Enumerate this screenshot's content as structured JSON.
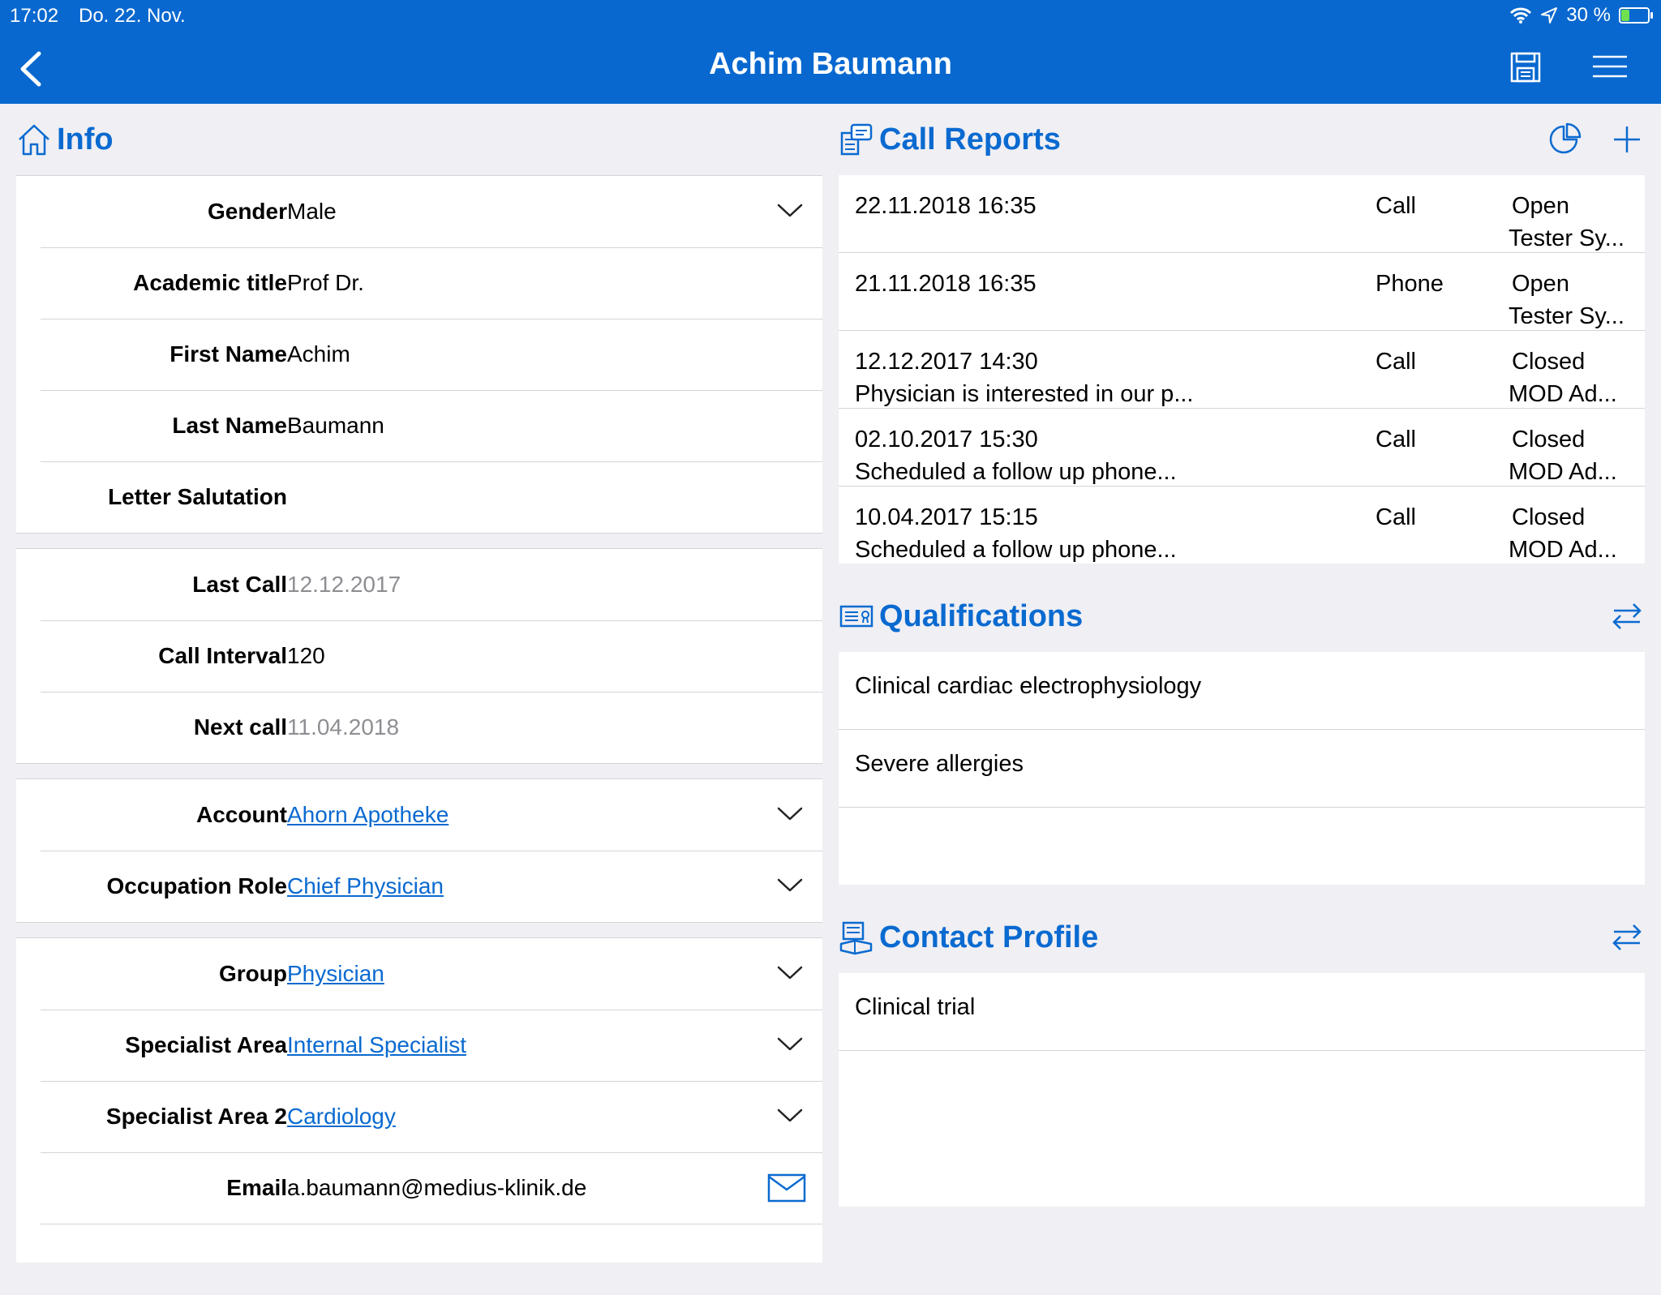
{
  "status": {
    "time": "17:02",
    "date": "Do. 22. Nov.",
    "battery": "30 %",
    "battery_level": 0.3
  },
  "nav": {
    "title": "Achim Baumann"
  },
  "info": {
    "title": "Info",
    "group1": [
      {
        "label": "Gender",
        "value": "Male"
      },
      {
        "label": "Academic title",
        "value": "Prof Dr."
      },
      {
        "label": "First Name",
        "value": "Achim"
      },
      {
        "label": "Last Name",
        "value": "Baumann"
      },
      {
        "label": "Letter Salutation",
        "value": ""
      }
    ],
    "group2": [
      {
        "label": "Last Call",
        "value": "12.12.2017"
      },
      {
        "label": "Call Interval",
        "value": "120"
      },
      {
        "label": "Next call",
        "value": "11.04.2018"
      }
    ],
    "group3": [
      {
        "label": "Account",
        "value": "Ahorn Apotheke"
      },
      {
        "label": "Occupation Role",
        "value": "Chief Physician"
      }
    ],
    "group4": [
      {
        "label": "Group",
        "value": "Physician"
      },
      {
        "label": "Specialist Area",
        "value": "Internal Specialist"
      },
      {
        "label": "Specialist Area 2",
        "value": "Cardiology"
      },
      {
        "label": "Email",
        "value": "a.baumann@medius-klinik.de"
      }
    ]
  },
  "call_reports": {
    "title": "Call Reports",
    "rows": [
      {
        "line1": "22.11.2018 16:35",
        "line2": "",
        "type": "Call",
        "status": "Open",
        "owner": "Tester Sy..."
      },
      {
        "line1": "21.11.2018 16:35",
        "line2": "",
        "type": "Phone",
        "status": "Open",
        "owner": "Tester Sy..."
      },
      {
        "line1": "12.12.2017 14:30",
        "line2": "Physician is interested in our p...",
        "type": "Call",
        "status": "Closed",
        "owner": "MOD Ad..."
      },
      {
        "line1": "02.10.2017 15:30",
        "line2": "Scheduled a follow up phone...",
        "type": "Call",
        "status": "Closed",
        "owner": "MOD Ad..."
      },
      {
        "line1": "10.04.2017 15:15",
        "line2": "Scheduled a follow up phone...",
        "type": "Call",
        "status": "Closed",
        "owner": "MOD Ad..."
      }
    ]
  },
  "qualifications": {
    "title": "Qualifications",
    "items": [
      "Clinical cardiac electrophysiology",
      "Severe allergies",
      ""
    ]
  },
  "contact_profile": {
    "title": "Contact Profile",
    "items": [
      "Clinical trial",
      ""
    ]
  }
}
